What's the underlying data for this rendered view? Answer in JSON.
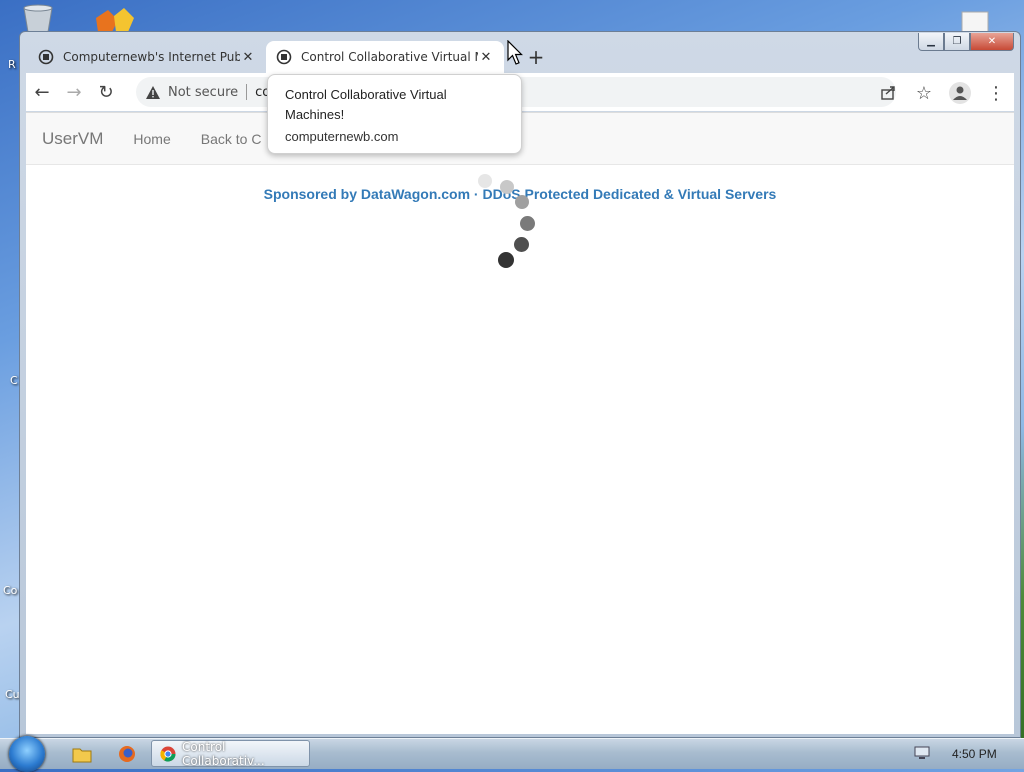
{
  "desktop": {
    "labels": [
      "R",
      "C",
      "Co",
      "Cu"
    ]
  },
  "browser": {
    "tabs": [
      {
        "title": "Computernewb's Internet Pub H",
        "active": false
      },
      {
        "title": "Control Collaborative Virtual Ma",
        "active": true
      }
    ],
    "new_tab": "+",
    "address": {
      "security": "Not secure",
      "url_visible": "co"
    }
  },
  "tooltip": {
    "title": "Control Collaborative Virtual Machines!",
    "url": "computernewb.com"
  },
  "page": {
    "brand": "UserVM",
    "nav": [
      "Home",
      "Back to C"
    ],
    "sponsor": "Sponsored by DataWagon.com · DDoS Protected Dedicated & Virtual Servers"
  },
  "taskbar": {
    "active_task": "Control Collaborativ...",
    "clock": "4:50 PM"
  },
  "colors": {
    "link": "#337ab7",
    "close_button": "#c74a36"
  }
}
